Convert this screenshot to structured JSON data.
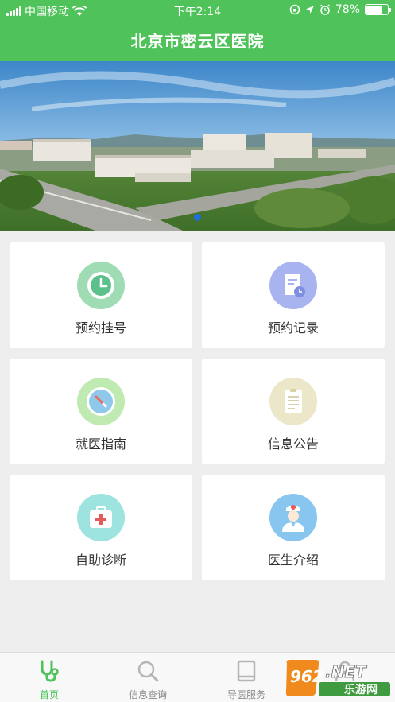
{
  "status_bar": {
    "carrier": "中国移动",
    "time": "下午2:14",
    "battery": "78%",
    "battery_level": 0.78
  },
  "header": {
    "title": "北京市密云区医院"
  },
  "banner": {
    "image": "hospital-aerial-photo",
    "active_slide": 1,
    "slide_count": 1
  },
  "tiles": [
    {
      "label": "预约挂号",
      "icon": "clock-icon",
      "color": "#9fdcb3"
    },
    {
      "label": "预约记录",
      "icon": "record-icon",
      "color": "#a8b4ef"
    },
    {
      "label": "就医指南",
      "icon": "compass-icon",
      "color": "#bfeab2"
    },
    {
      "label": "信息公告",
      "icon": "notice-icon",
      "color": "#ece7c8"
    },
    {
      "label": "自助诊断",
      "icon": "first-aid-icon",
      "color": "#9de3df"
    },
    {
      "label": "医生介绍",
      "icon": "doctor-icon",
      "color": "#89c6ef"
    }
  ],
  "tabbar": {
    "items": [
      {
        "label": "首页",
        "icon": "stethoscope-icon",
        "active": true
      },
      {
        "label": "信息查询",
        "icon": "search-icon",
        "active": false
      },
      {
        "label": "导医服务",
        "icon": "book-icon",
        "active": false
      },
      {
        "label": "",
        "icon": "profile-icon",
        "active": false
      }
    ]
  },
  "watermark": {
    "top": "962.NET",
    "bottom": "乐游网"
  },
  "colors": {
    "brand": "#4fc25a",
    "dot": "#1e6fd9"
  }
}
